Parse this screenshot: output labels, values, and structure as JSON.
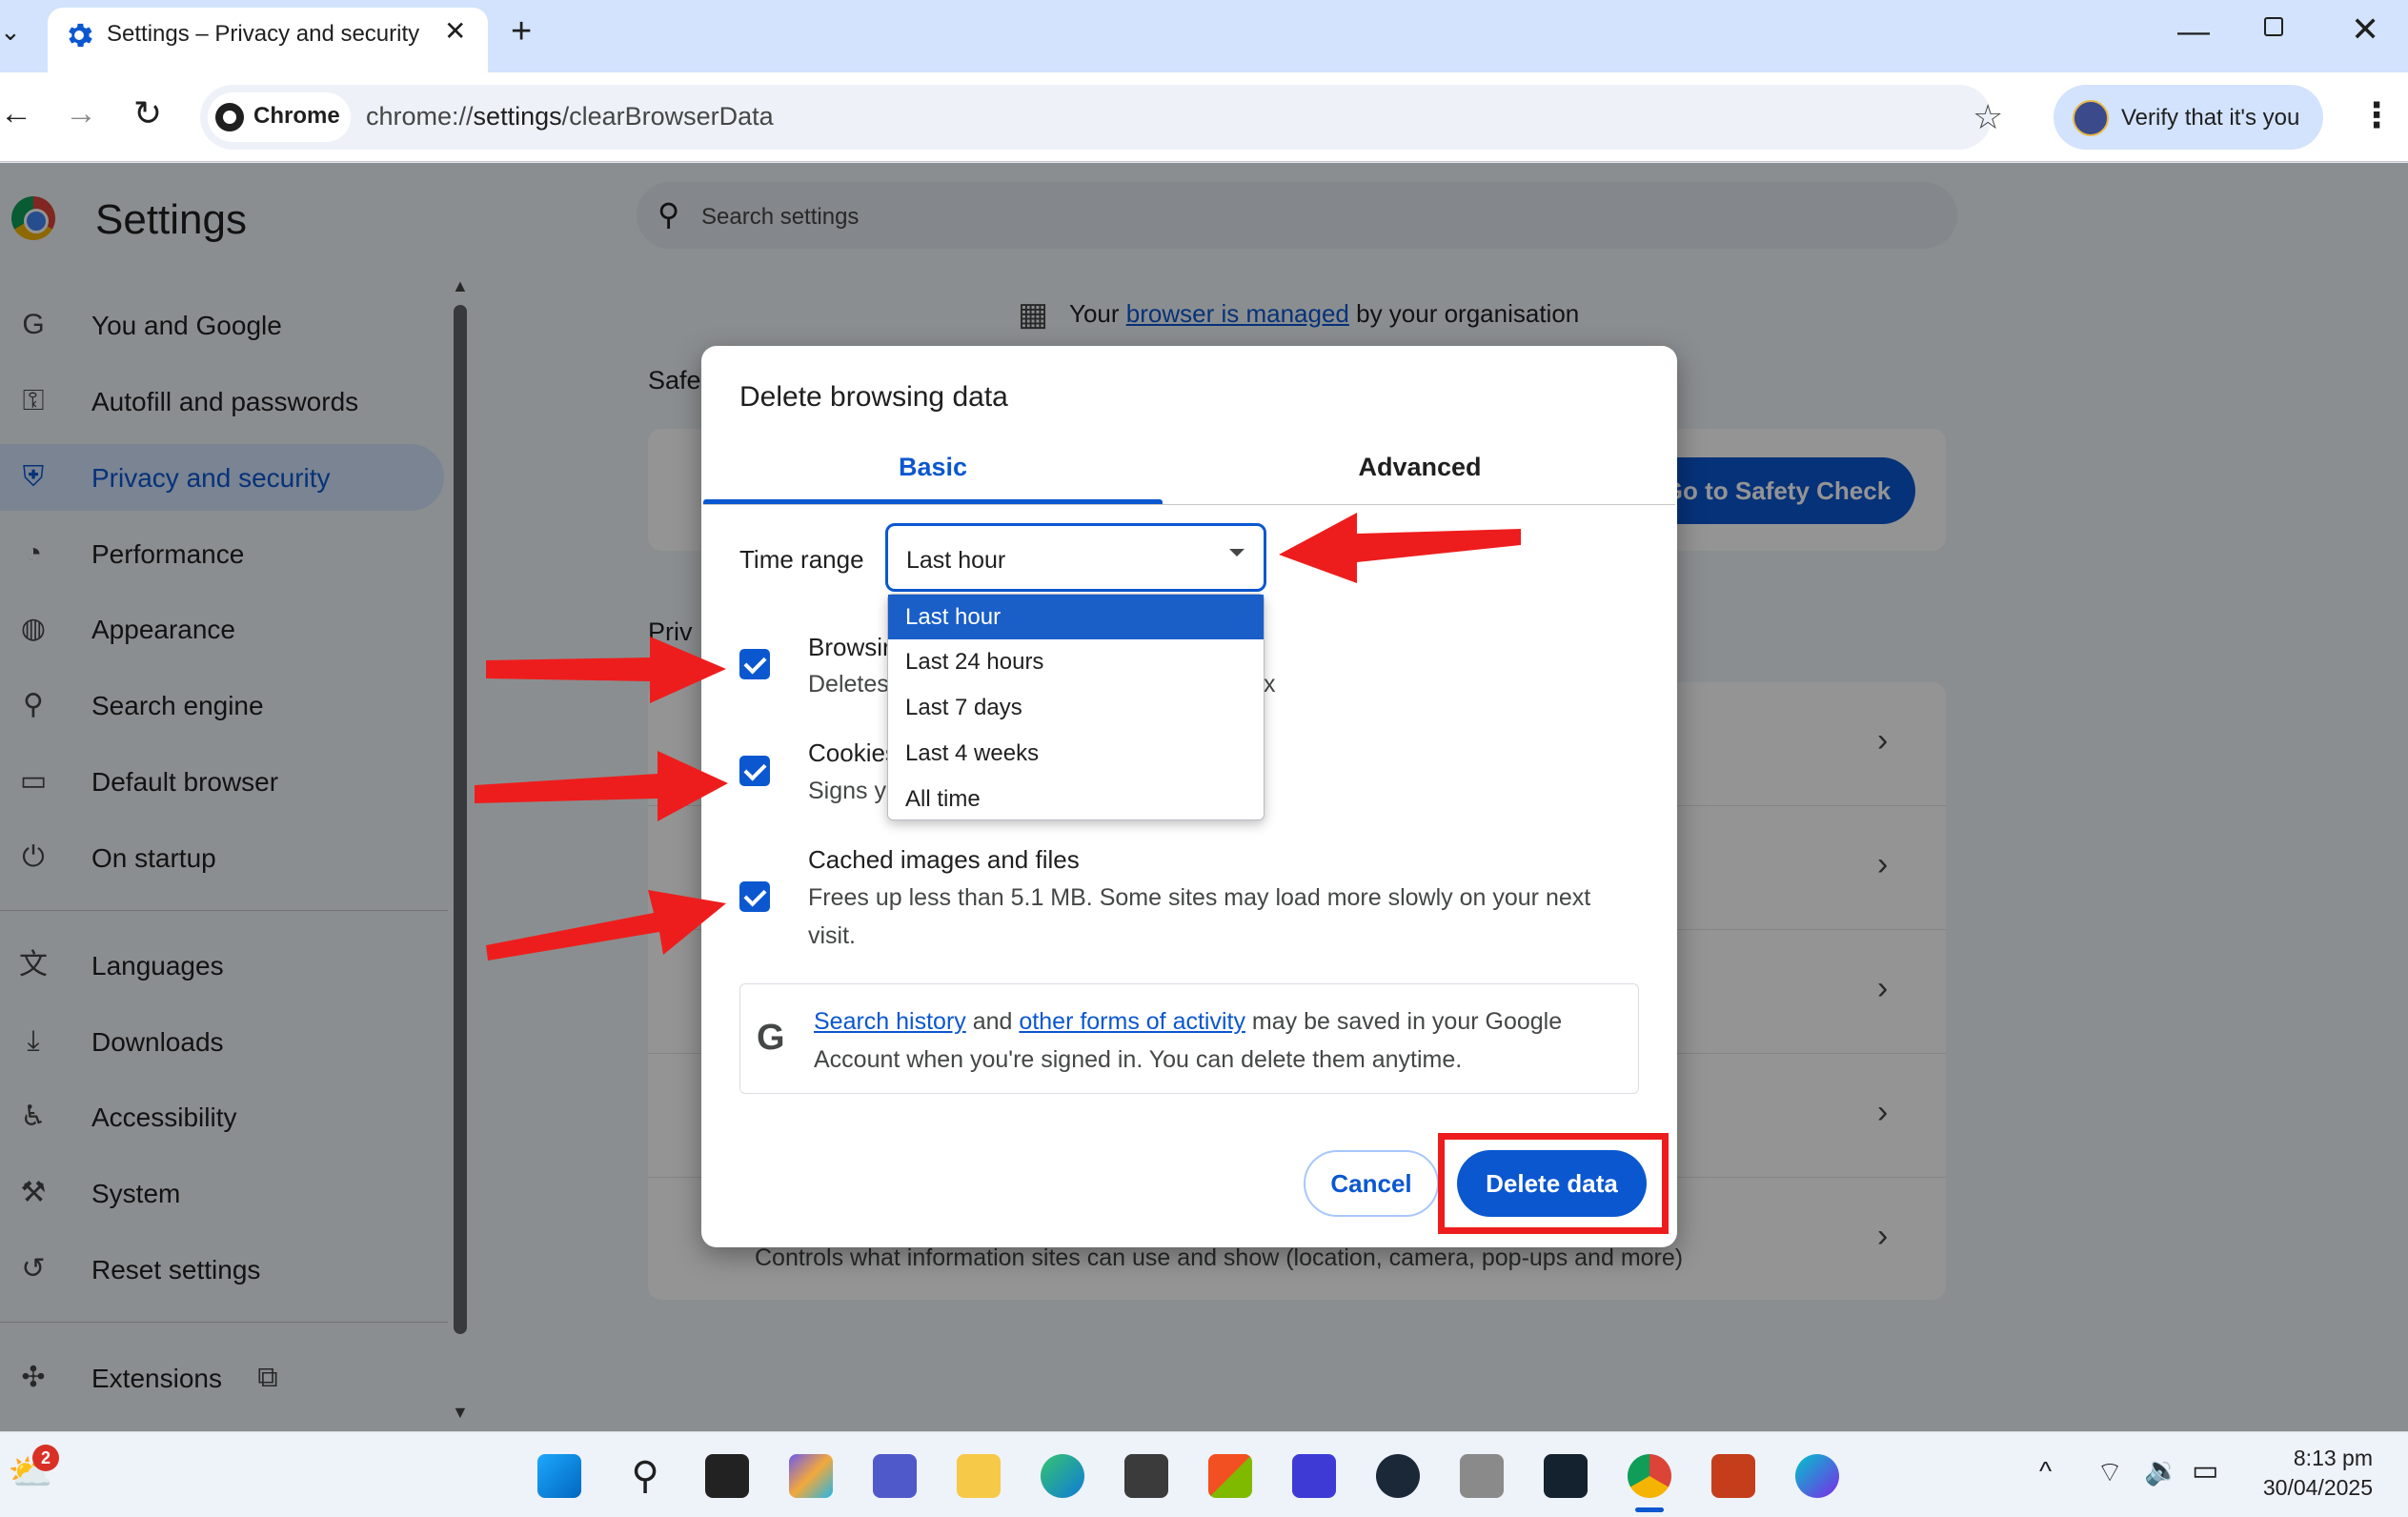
{
  "tab": {
    "title": "Settings – Privacy and security"
  },
  "toolbar": {
    "chip_label": "Chrome",
    "url_prefix": "chrome://",
    "url_host": "settings",
    "url_path": "/clearBrowserData",
    "verify_label": "Verify that it's you"
  },
  "settings": {
    "title": "Settings",
    "search_placeholder": "Search settings",
    "managed_prefix": "Your ",
    "managed_link": "browser is managed",
    "managed_suffix": " by your organisation",
    "safety_label": "Safe",
    "safety_button": "Go to Safety Check",
    "privacy_label": "Priv",
    "last_row_sub": "Controls what information sites can use and show (location, camera, pop-ups and more)"
  },
  "sidebar": {
    "items": [
      {
        "label": "You and Google",
        "icon": "google-g-icon"
      },
      {
        "label": "Autofill and passwords",
        "icon": "key-icon"
      },
      {
        "label": "Privacy and security",
        "icon": "shield-icon",
        "active": true
      },
      {
        "label": "Performance",
        "icon": "gauge-icon"
      },
      {
        "label": "Appearance",
        "icon": "palette-icon"
      },
      {
        "label": "Search engine",
        "icon": "search-icon"
      },
      {
        "label": "Default browser",
        "icon": "browser-window-icon"
      },
      {
        "label": "On startup",
        "icon": "power-icon"
      },
      {
        "label": "Languages",
        "icon": "translate-icon"
      },
      {
        "label": "Downloads",
        "icon": "download-icon"
      },
      {
        "label": "Accessibility",
        "icon": "accessibility-icon"
      },
      {
        "label": "System",
        "icon": "wrench-icon"
      },
      {
        "label": "Reset settings",
        "icon": "reset-icon"
      },
      {
        "label": "Extensions",
        "icon": "puzzle-icon"
      }
    ]
  },
  "dialog": {
    "title": "Delete browsing data",
    "tabs": {
      "basic": "Basic",
      "advanced": "Advanced"
    },
    "time_range_label": "Time range",
    "time_range_value": "Last hour",
    "time_range_options": [
      "Last hour",
      "Last 24 hours",
      "Last 7 days",
      "Last 4 weeks",
      "All time"
    ],
    "options": [
      {
        "title": "Browsir",
        "sub": "Deletes",
        "trailing": "x",
        "checked": true
      },
      {
        "title": "Cookies",
        "sub": "Signs y",
        "checked": true
      },
      {
        "title": "Cached images and files",
        "sub_line1": "Frees up less than 5.1 MB. Some sites may load more slowly on your next",
        "sub_line2": "visit.",
        "checked": true
      }
    ],
    "info": {
      "link1": "Search history",
      "and": " and ",
      "link2": "other forms of activity",
      "rest1": " may be saved in your Google",
      "line2": "Account when you're signed in. You can delete them anytime."
    },
    "cancel": "Cancel",
    "delete": "Delete data"
  },
  "taskbar": {
    "weather_badge": "2",
    "time": "8:13 pm",
    "date": "30/04/2025"
  },
  "colors": {
    "accent": "#0b57d0",
    "annotation_red": "#ee1d1d"
  }
}
